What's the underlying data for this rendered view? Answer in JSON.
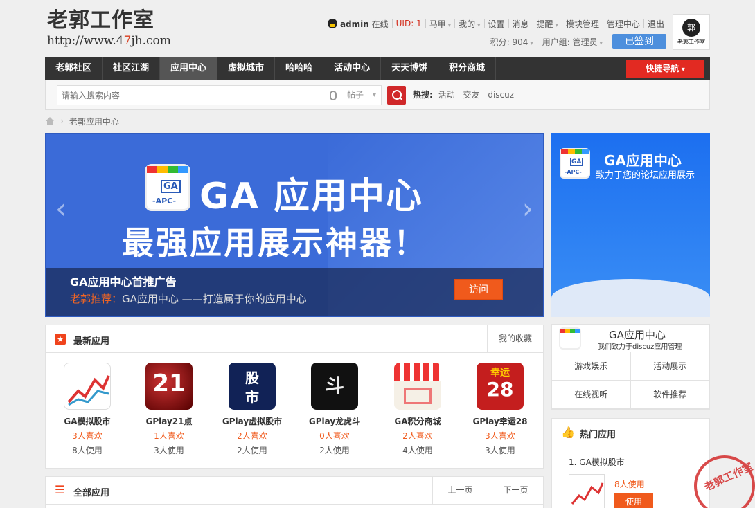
{
  "logo": {
    "title": "老郭工作室",
    "url_pre": "http://www.4",
    "url_mid": "7",
    "url_post": "jh.com"
  },
  "topnav": {
    "user": "admin",
    "online": "在线",
    "uid": "UID: 1",
    "items": [
      "马甲",
      "我的",
      "设置",
      "消息",
      "提醒",
      "模块管理",
      "管理中心",
      "退出"
    ]
  },
  "subnav": {
    "points": "积分: 904",
    "group": "用户组: 管理员",
    "signed": "已签到"
  },
  "avatar": {
    "text": "老郭工作室"
  },
  "nav": {
    "items": [
      "老郭社区",
      "社区江湖",
      "应用中心",
      "虚拟城市",
      "哈哈哈",
      "活动中心",
      "天天博饼",
      "积分商城"
    ],
    "quick": "快捷导航"
  },
  "search": {
    "placeholder": "请输入搜索内容",
    "type": "帖子",
    "hot_label": "热搜:",
    "hot": [
      "活动",
      "交友",
      "discuz"
    ]
  },
  "crumb": {
    "current": "老郭应用中心"
  },
  "banner": {
    "title": "GA 应用中心",
    "slogan": "最强应用展示神器！",
    "bag_ga": "GA",
    "bag_apc": "-APC-",
    "caption_title": "GA应用中心首推广告",
    "caption_tag": "老郭推荐：",
    "caption_text": "GA应用中心 ——打造属于你的应用中心",
    "visit": "访问"
  },
  "sidebanner": {
    "title": "GA应用中心",
    "subtitle": "致力于您的论坛应用展示"
  },
  "newest": {
    "title": "最新应用",
    "fav": "我的收藏",
    "apps": [
      {
        "name": "GA模拟股市",
        "likes": "3人喜欢",
        "users": "8人使用"
      },
      {
        "name": "GPlay21点",
        "likes": "1人喜欢",
        "users": "3人使用"
      },
      {
        "name": "GPlay虚拟股市",
        "likes": "2人喜欢",
        "users": "2人使用"
      },
      {
        "name": "GPlay龙虎斗",
        "likes": "0人喜欢",
        "users": "2人使用"
      },
      {
        "name": "GA积分商城",
        "likes": "2人喜欢",
        "users": "4人使用"
      },
      {
        "name": "GPlay幸运28",
        "likes": "3人喜欢",
        "users": "3人使用"
      }
    ]
  },
  "allapps": {
    "title": "全部应用",
    "prev": "上一页",
    "next": "下一页"
  },
  "ginfo": {
    "title": "GA应用中心",
    "subtitle": "我们致力于discuz应用管理",
    "links": [
      "游戏娱乐",
      "活动展示",
      "在线视听",
      "软件推荐"
    ]
  },
  "hotapps": {
    "title": "热门应用",
    "first": "1. GA模拟股市",
    "users": "8人使用",
    "use": "使用"
  },
  "stamp": {
    "text": "老郭工作室"
  },
  "colors": {
    "accent": "#f05a1c",
    "nav": "#333333",
    "banner": "#3b6bd8",
    "signed": "#4d8fdd"
  }
}
